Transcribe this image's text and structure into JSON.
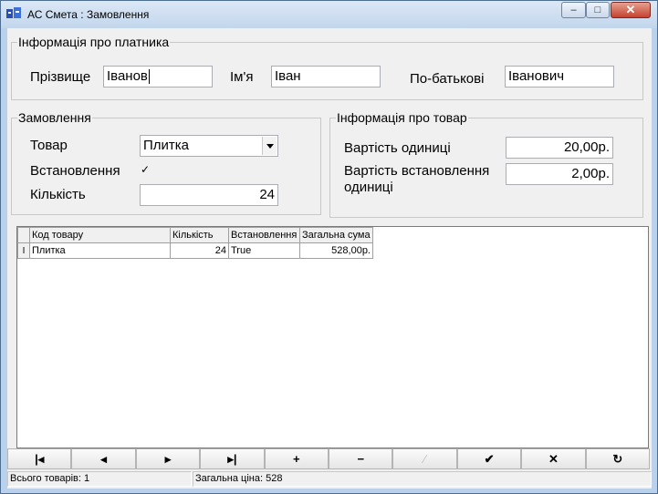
{
  "window": {
    "title": "АС Смета : Замовлення",
    "controls": {
      "minimize": "–",
      "maximize": "□",
      "close": "✕"
    }
  },
  "payer": {
    "legend": "Інформація про платника",
    "surname_label": "Прізвище",
    "surname_value": "Іванов",
    "name_label": "Ім'я",
    "name_value": "Іван",
    "patronymic_label": "По-батькові",
    "patronymic_value": "Іванович"
  },
  "order": {
    "legend": "Замовлення",
    "product_label": "Товар",
    "product_value": "Плитка",
    "install_label": "Встановлення",
    "install_checked": "✓",
    "quantity_label": "Кількість",
    "quantity_value": "24"
  },
  "product_info": {
    "legend": "Інформація про товар",
    "unit_cost_label": "Вартість одиниці",
    "unit_cost_value": "20,00р.",
    "install_cost_label_line1": "Вартість встановлення",
    "install_cost_label_line2": "одиниці",
    "install_cost_value": "2,00р."
  },
  "grid": {
    "columns": [
      "Код товару",
      "Кількість",
      "Встановлення",
      "Загальна сума"
    ],
    "row_indicator": "I",
    "rows": [
      [
        "Плитка",
        "24",
        "True",
        "528,00р."
      ]
    ]
  },
  "navigator": {
    "buttons": [
      {
        "icon": "first-record-icon",
        "glyph": "|◂"
      },
      {
        "icon": "prior-record-icon",
        "glyph": "◂"
      },
      {
        "icon": "next-record-icon",
        "glyph": "▸"
      },
      {
        "icon": "last-record-icon",
        "glyph": "▸|"
      },
      {
        "icon": "insert-record-icon",
        "glyph": "+"
      },
      {
        "icon": "delete-record-icon",
        "glyph": "−"
      },
      {
        "icon": "edit-record-icon",
        "glyph": "⁄"
      },
      {
        "icon": "post-record-icon",
        "glyph": "✔"
      },
      {
        "icon": "cancel-record-icon",
        "glyph": "✕"
      },
      {
        "icon": "refresh-records-icon",
        "glyph": "↻"
      }
    ]
  },
  "status": {
    "total_items": "Всього товарів: 1",
    "total_price": "Загальна ціна: 528"
  }
}
